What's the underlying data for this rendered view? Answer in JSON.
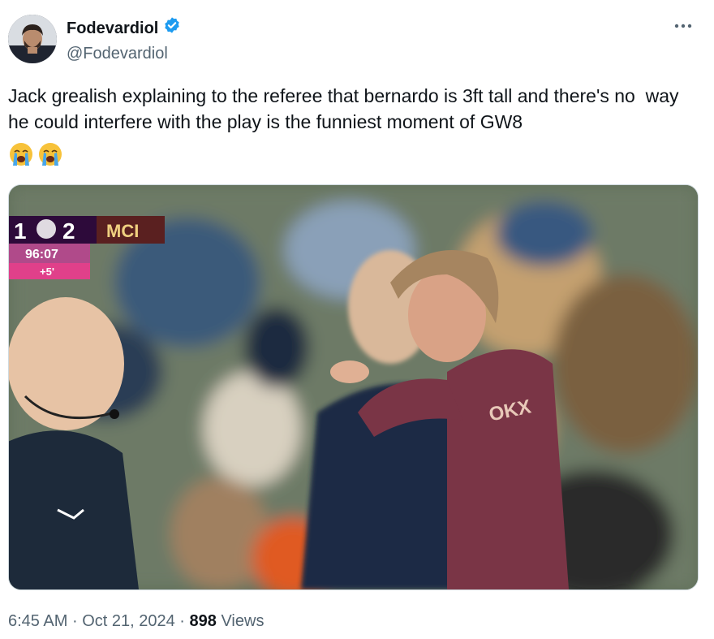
{
  "author": {
    "display_name": "Fodevardiol",
    "handle": "@Fodevardiol",
    "verified": true,
    "verified_color": "#1d9bf0"
  },
  "post": {
    "text": "Jack grealish explaining to the referee that bernardo is 3ft tall and there's no  way he could interfere with the play is the funniest moment of GW8",
    "emojis": [
      "loudly-crying-face",
      "loudly-crying-face"
    ]
  },
  "media": {
    "scoreboard": {
      "home_score": "1",
      "away_score": "2",
      "away_team": "MCI",
      "clock": "96:07",
      "added_time": "+5'"
    },
    "shirt_sponsor": "OKX"
  },
  "meta": {
    "time": "6:45 AM",
    "separator": "·",
    "date": "Oct 21, 2024",
    "views_count": "898",
    "views_label": "Views"
  },
  "icons": {
    "more": "more-horizontal-icon",
    "verified": "verified-badge-icon"
  }
}
